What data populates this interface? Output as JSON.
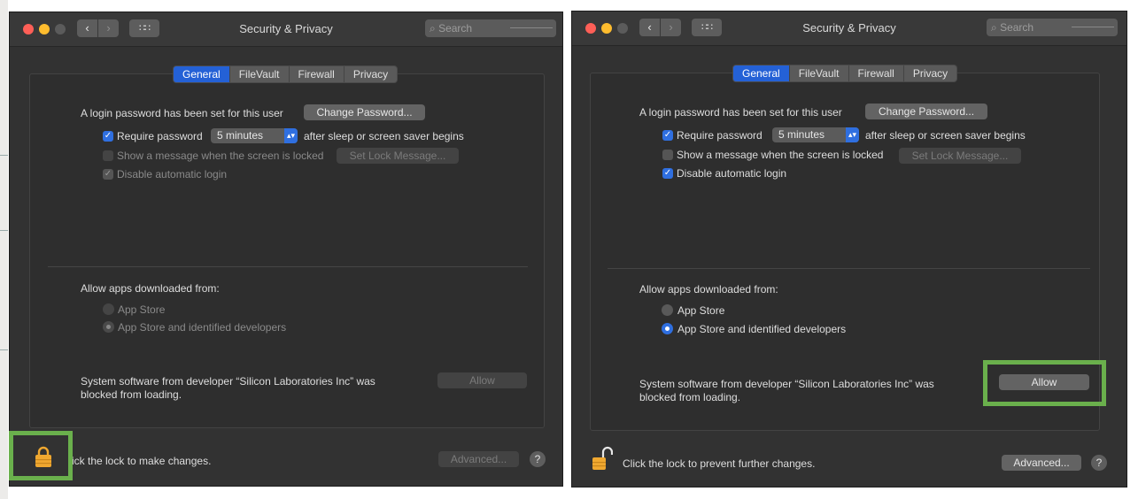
{
  "window_title": "Security & Privacy",
  "search_placeholder": "Search",
  "tabs": [
    "General",
    "FileVault",
    "Firewall",
    "Privacy"
  ],
  "login_password_text": "A login password has been set for this user",
  "change_password_label": "Change Password...",
  "require_password_label": "Require password",
  "require_password_delay": "5 minutes",
  "after_sleep_text": "after sleep or screen saver begins",
  "show_message_label": "Show a message when the screen is locked",
  "set_lock_message_label": "Set Lock Message...",
  "disable_auto_login_label": "Disable automatic login",
  "allow_apps_heading": "Allow apps downloaded from:",
  "app_store_option": "App Store",
  "app_store_identified_option": "App Store and identified developers",
  "blocked_line1": "System software from developer “Silicon Laboratories Inc” was",
  "blocked_line2": "blocked from loading.",
  "allow_label": "Allow",
  "advanced_label": "Advanced...",
  "help_label": "?",
  "left": {
    "lock_status_text": "ick the lock to make changes."
  },
  "right": {
    "lock_status_text": "Click the lock to prevent further changes."
  },
  "colors": {
    "accent": "#2f6fe0",
    "tab_active": "#2461d6",
    "highlight": "#6ab04c",
    "lock": "#f0a830"
  }
}
